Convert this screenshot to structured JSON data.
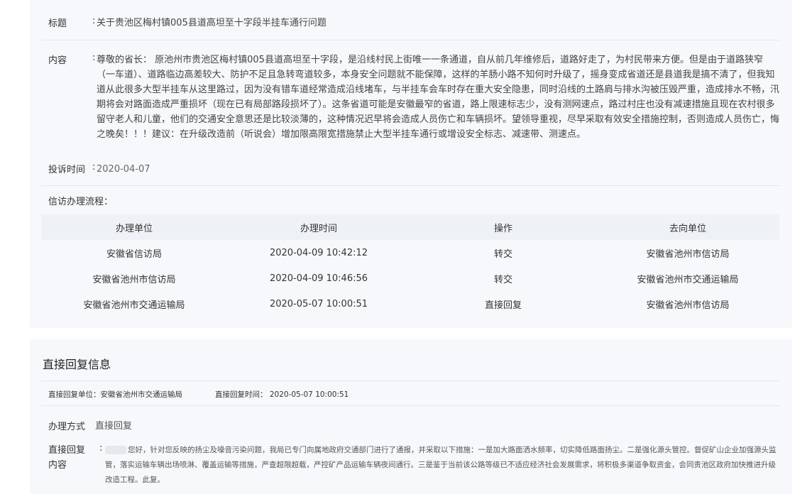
{
  "complaint": {
    "title_label": "标题",
    "title_value": "关于贵池区梅村镇005县道高坦至十字段半挂车通行问题",
    "content_label": "内容",
    "content_value": "尊敬的省长： 原池州市贵池区梅村镇005县道高坦至十字段，是沿线村民上街唯一一条通道，自从前几年维修后，道路好走了，为村民带来方便。但是由于道路狭窄（一车道）、道路临边高差较大、防护不足且急转弯道较多，本身安全问题就不能保障，这样的羊肠小路不知何时升级了，摇身变成省道还是县道我是搞不清了，但我知道从此很多大型半挂车从这里路过，因为没有错车道经常造成沿线堵车，与半挂车会车时存在重大安全隐患，同时沿线的土路肩与排水沟被压毁严重，造成排水不畅，汛期将会对路面造成严重损坏（现在已有局部路段损坏了）。这条省道可能是安徽最窄的省道，路上限速标志少，没有测网速点，路过村庄也没有减速措施且现在农村很多留守老人和儿童，他们的交通安全意思还是比较淡薄的，这种情况迟早将会造成人员伤亡和车辆损坏。望领导重视，尽早采取有效安全措施控制，否则造成人员伤亡，悔之晚矣！！！建议：在升级改造前（听说会）增加限高限宽措施禁止大型半挂车通行或增设安全标志、减速带、测速点。",
    "date_label": "投诉时间",
    "date_value": "2020-04-07",
    "colon": ":"
  },
  "flow": {
    "label": "信访办理流程：",
    "headers": [
      "办理单位",
      "办理时间",
      "操作",
      "去向单位"
    ],
    "rows": [
      [
        "安徽省信访局",
        "2020-04-09 10:42:12",
        "转交",
        "安徽省池州市信访局"
      ],
      [
        "安徽省池州市信访局",
        "2020-04-09 10:46:56",
        "转交",
        "安徽省池州市交通运输局"
      ],
      [
        "安徽省池州市交通运输局",
        "2020-05-07 10:00:51",
        "直接回复",
        "安徽省池州市信访局"
      ]
    ]
  },
  "reply": {
    "title": "直接回复信息",
    "unit_meta": "直接回复单位：安徽省池州市交通运输局",
    "time_meta": "直接回复时间： 2020-05-07 10:00:51",
    "method_label": "办理方式",
    "method_value": "直接回复",
    "content_label_line1": "直接回复",
    "content_label_line2": "内容",
    "content_value": "您好，针对您反映的扬尘及噪音污染问题，我局已专门向属地政府交通部门进行了通报，并采取以下措施：一是加大路面洒水频率，切实降低路面扬尘。二是强化源头管控。督促矿山企业加强源头监管，落实运输车辆出场喷淋、覆盖运输等措施，严查超限超载，严控矿产品运输车辆夜间通行。三是鉴于当前该公路等级已不适应经济社会发展需求，将积极多渠道争取资金，会同贵池区政府加快推进升级改造工程。此复。"
  }
}
